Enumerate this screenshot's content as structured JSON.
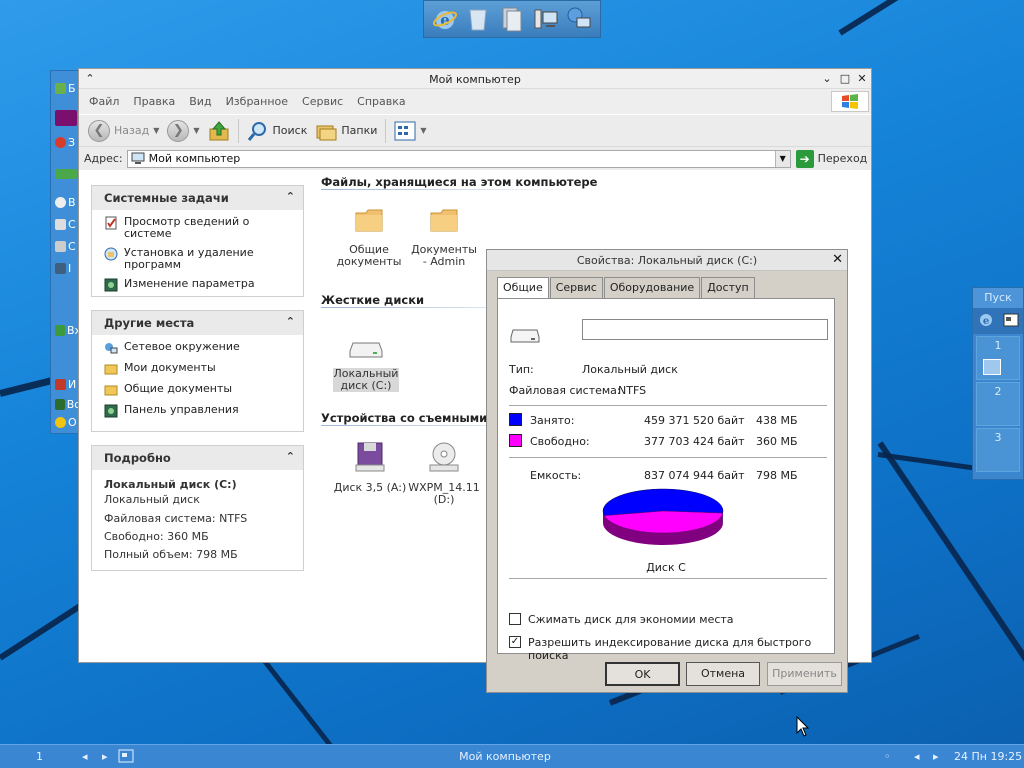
{
  "colors": {
    "desktop": "#1583d8",
    "used": "#0000ff",
    "free": "#ff00ff",
    "pie_shadow_used": "#00008b",
    "pie_shadow_free": "#800080"
  },
  "launcher": {
    "icons": [
      "internet-explorer-icon",
      "recycle-bin-icon",
      "documents-icon",
      "my-computer-icon",
      "network-icon"
    ]
  },
  "explorer": {
    "title": "Мой компьютер",
    "menu": [
      "Файл",
      "Правка",
      "Вид",
      "Избранное",
      "Сервис",
      "Справка"
    ],
    "toolbar": {
      "back": "Назад",
      "search": "Поиск",
      "folders": "Папки"
    },
    "address": {
      "label": "Адрес:",
      "value": "Мой компьютер",
      "go": "Переход"
    },
    "system_tasks": {
      "title": "Системные задачи",
      "items": [
        "Просмотр сведений о системе",
        "Установка и удаление программ",
        "Изменение параметра"
      ]
    },
    "other_places": {
      "title": "Другие места",
      "items": [
        "Сетевое окружение",
        "Мои документы",
        "Общие документы",
        "Панель управления"
      ]
    },
    "details": {
      "title": "Подробно",
      "name": "Локальный диск (C:)",
      "type": "Локальный диск",
      "fs": "Файловая система: NTFS",
      "free": "Свободно: 360 МБ",
      "total": "Полный объем: 798 МБ"
    },
    "groups": {
      "files": {
        "title": "Файлы, хранящиеся на этом компьютере",
        "items": [
          "Общие документы",
          "Документы - Admin"
        ]
      },
      "disks": {
        "title": "Жесткие диски",
        "items": [
          "Локальный диск (C:)"
        ]
      },
      "removable": {
        "title": "Устройства со съемными",
        "items": [
          "Диск 3,5 (A:)",
          "WXPM_14.11 (D:)"
        ]
      }
    }
  },
  "properties": {
    "title": "Свойства: Локальный диск (C:)",
    "tabs": [
      "Общие",
      "Сервис",
      "Оборудование",
      "Доступ"
    ],
    "label_value": "",
    "type_label": "Тип:",
    "type_value": "Локальный диск",
    "fs_label": "Файловая система:",
    "fs_value": "NTFS",
    "used_label": "Занято:",
    "used_bytes": "459 371 520 байт",
    "used_mb": "438 МБ",
    "free_label": "Свободно:",
    "free_bytes": "377 703 424 байт",
    "free_mb": "360 МБ",
    "capacity_label": "Емкость:",
    "capacity_bytes": "837 074 944 байт",
    "capacity_mb": "798 МБ",
    "disk_label": "Диск C",
    "used_fraction": 0.549,
    "compress_label": "Сжимать диск для экономии места",
    "compress_checked": false,
    "index_label": "Разрешить индексирование диска для быстрого поиска",
    "index_checked": true,
    "buttons": {
      "ok": "OK",
      "cancel": "Отмена",
      "apply": "Применить"
    }
  },
  "pager": {
    "start": "Пуск",
    "workspaces": [
      "1",
      "2",
      "3"
    ]
  },
  "taskbar": {
    "desk_number": "1",
    "task": "Мой компьютер",
    "clock": "24 Пн 19:25"
  }
}
